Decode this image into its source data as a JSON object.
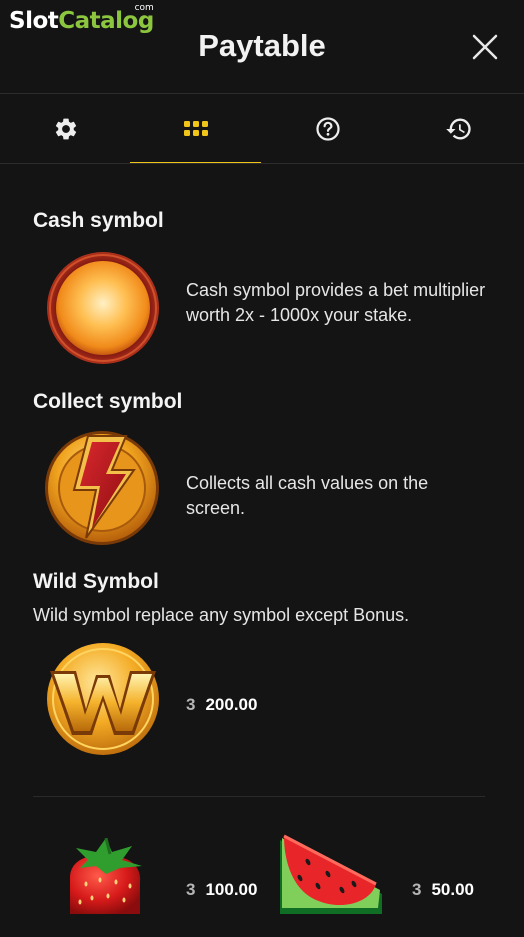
{
  "logo": {
    "part1": "Slot",
    "part2": "Catalog",
    "suffix": "com"
  },
  "header": {
    "title": "Paytable"
  },
  "tabs": [
    {
      "name": "settings",
      "icon": "gear-icon"
    },
    {
      "name": "paytable",
      "icon": "grid-icon",
      "active": true
    },
    {
      "name": "help",
      "icon": "question-icon"
    },
    {
      "name": "history",
      "icon": "history-icon"
    }
  ],
  "colors": {
    "accent": "#f0c419",
    "logo_green": "#8cc63f",
    "background": "#141414"
  },
  "sections": {
    "cash": {
      "title": "Cash symbol",
      "description": "Cash symbol provides a bet multiplier worth 2x - 1000x your stake."
    },
    "collect": {
      "title": "Collect symbol",
      "description": "Collects all cash values on the screen."
    },
    "wild": {
      "title": "Wild Symbol",
      "description": "Wild symbol replace any symbol except Bonus.",
      "count": "3",
      "payout": "200.00"
    }
  },
  "symbols": [
    {
      "name": "strawberry",
      "count": "3",
      "payout": "100.00"
    },
    {
      "name": "watermelon",
      "count": "3",
      "payout": "50.00"
    }
  ]
}
